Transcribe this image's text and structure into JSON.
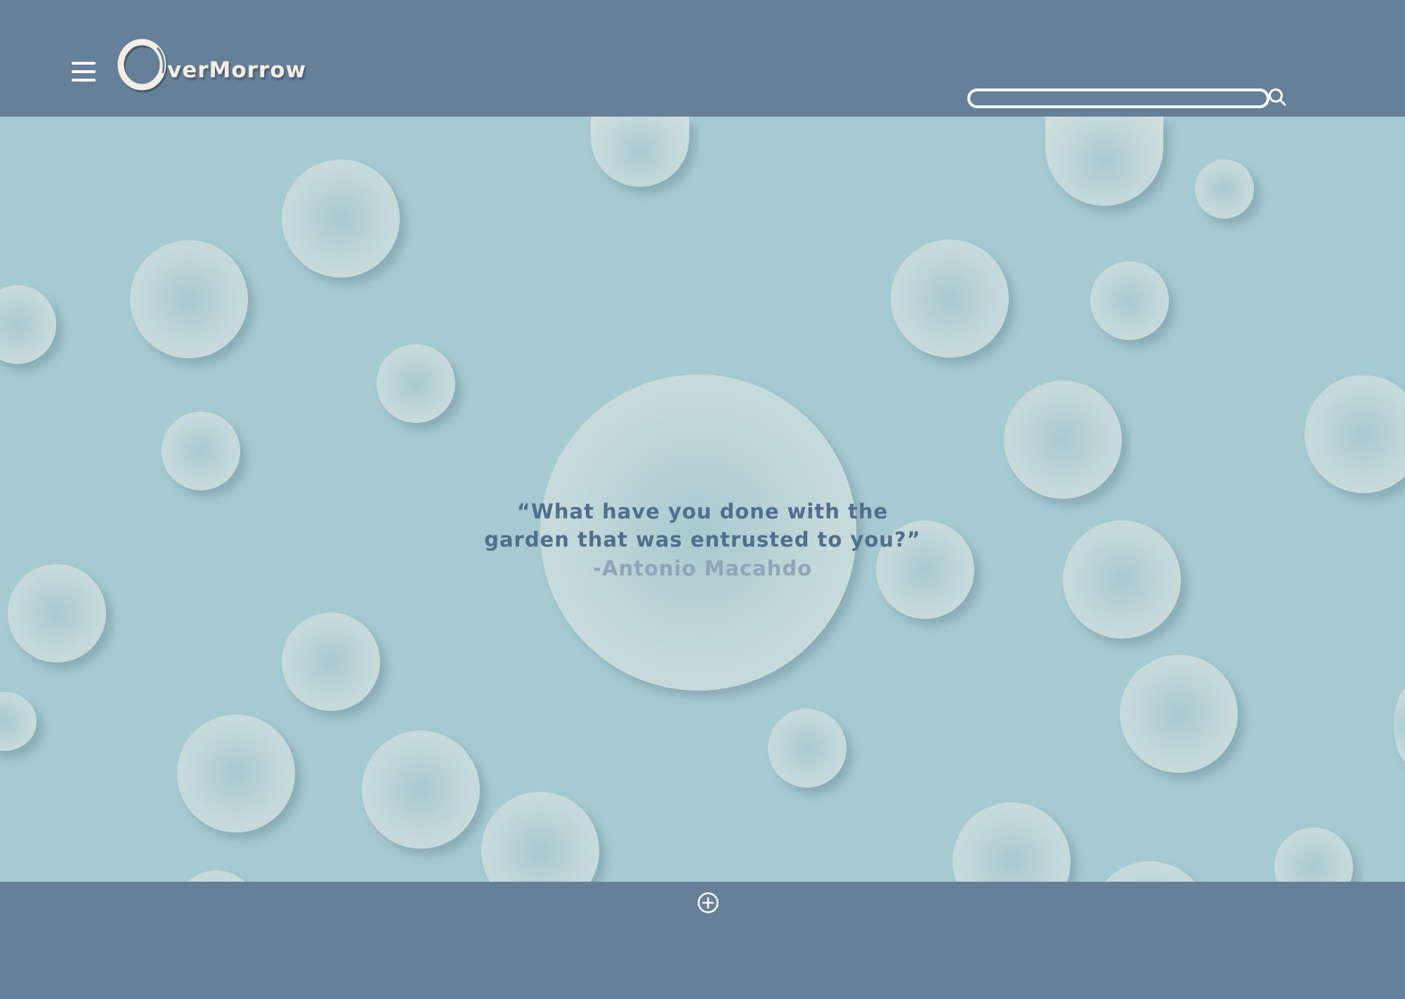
{
  "header": {
    "logo_text": "verMorrow",
    "logo_full": "OverMorrow",
    "menu_icon": "hamburger-menu-icon",
    "search": {
      "value": "",
      "placeholder": "",
      "icon": "search-icon"
    }
  },
  "hero": {
    "quote": {
      "line1": "“What have you done with the",
      "line2": "garden that was entrusted to you?”",
      "author": "-Antonio Macahdo"
    }
  },
  "footer": {
    "add_icon": "plus-circle-icon"
  },
  "colors": {
    "bar": "#67809a",
    "background": "#a6cad2",
    "bubble": "#d3e0de",
    "quote_text": "#506f8d",
    "quote_author": "#8ea6b8",
    "logo": "#f2efe4"
  }
}
